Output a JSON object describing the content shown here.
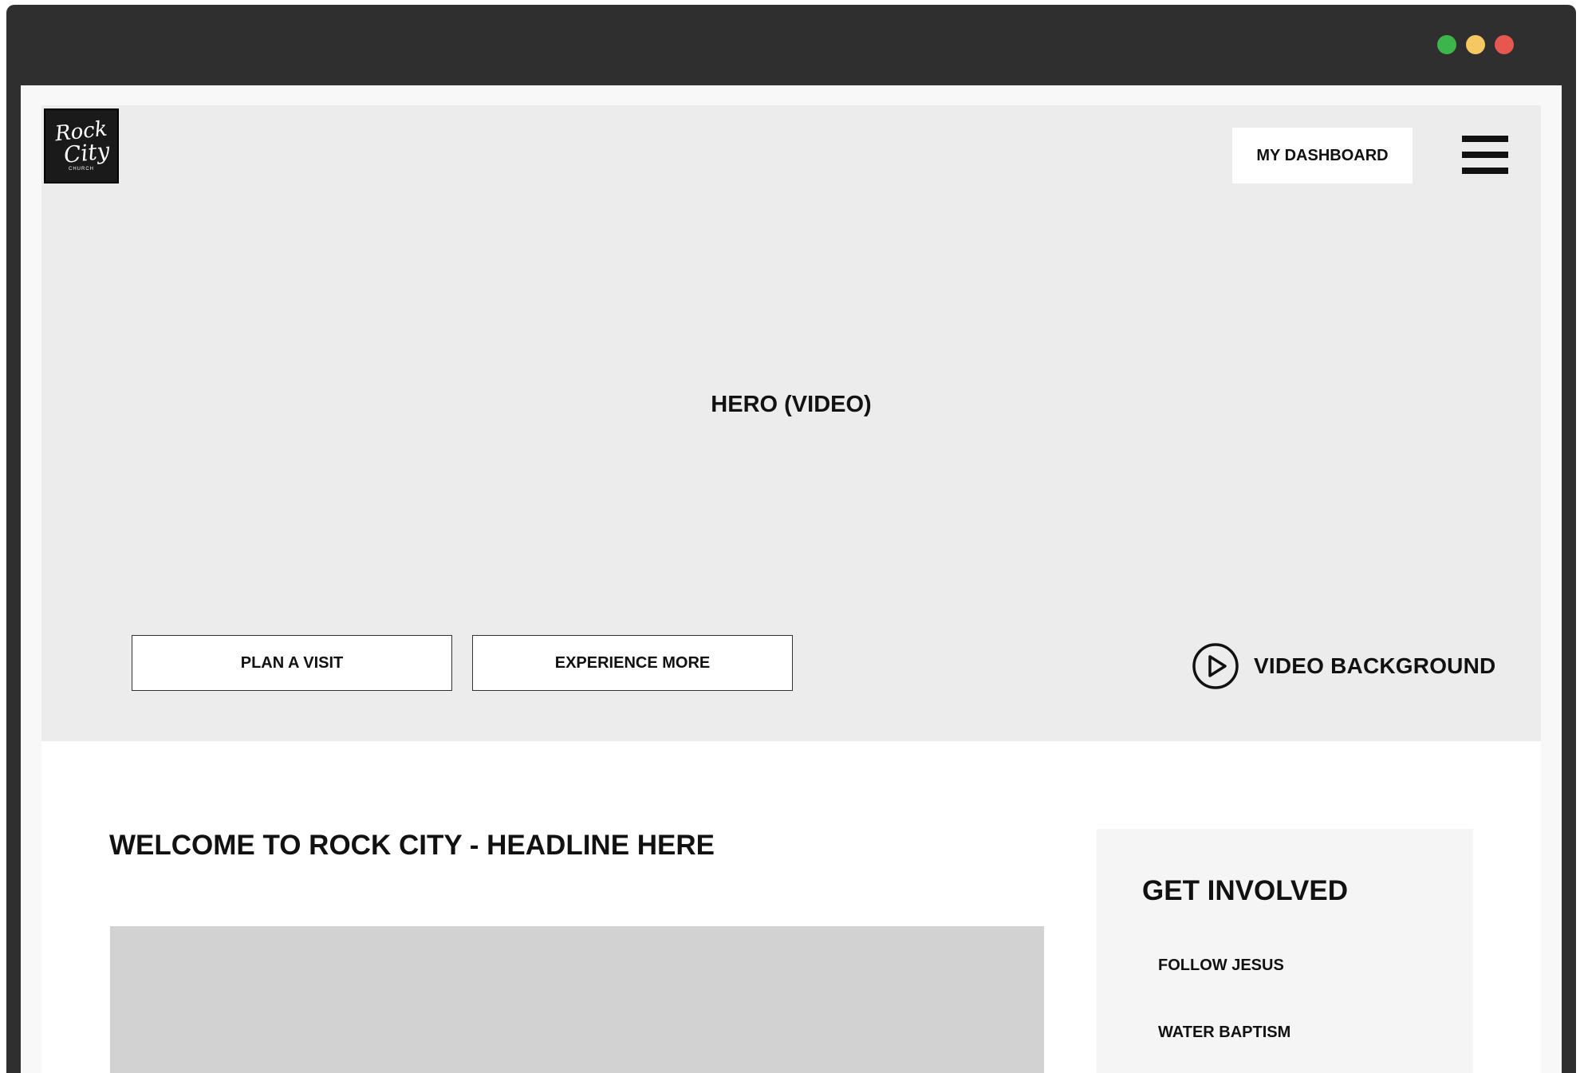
{
  "window": {
    "dots": [
      {
        "name": "green-dot",
        "color": "#3cb54a"
      },
      {
        "name": "yellow-dot",
        "color": "#f5c862"
      },
      {
        "name": "red-dot",
        "color": "#e5574f"
      }
    ]
  },
  "header": {
    "logo": {
      "line1": "Rock",
      "line2": "City",
      "line3": "CHURCH"
    },
    "dashboard_label": "MY DASHBOARD",
    "menu_icon": "hamburger-menu-icon"
  },
  "hero": {
    "label": "HERO (VIDEO)",
    "plan_visit_label": "PLAN A VISIT",
    "experience_more_label": "EXPERIENCE MORE",
    "video_background_label": "VIDEO BACKGROUND",
    "video_icon": "play-circle-icon",
    "background_color": "#ececec"
  },
  "main": {
    "headline": "WELCOME TO ROCK CITY - HEADLINE HERE"
  },
  "sidebar": {
    "title": "GET INVOLVED",
    "items": [
      {
        "label": "FOLLOW JESUS"
      },
      {
        "label": "WATER BAPTISM"
      }
    ]
  }
}
